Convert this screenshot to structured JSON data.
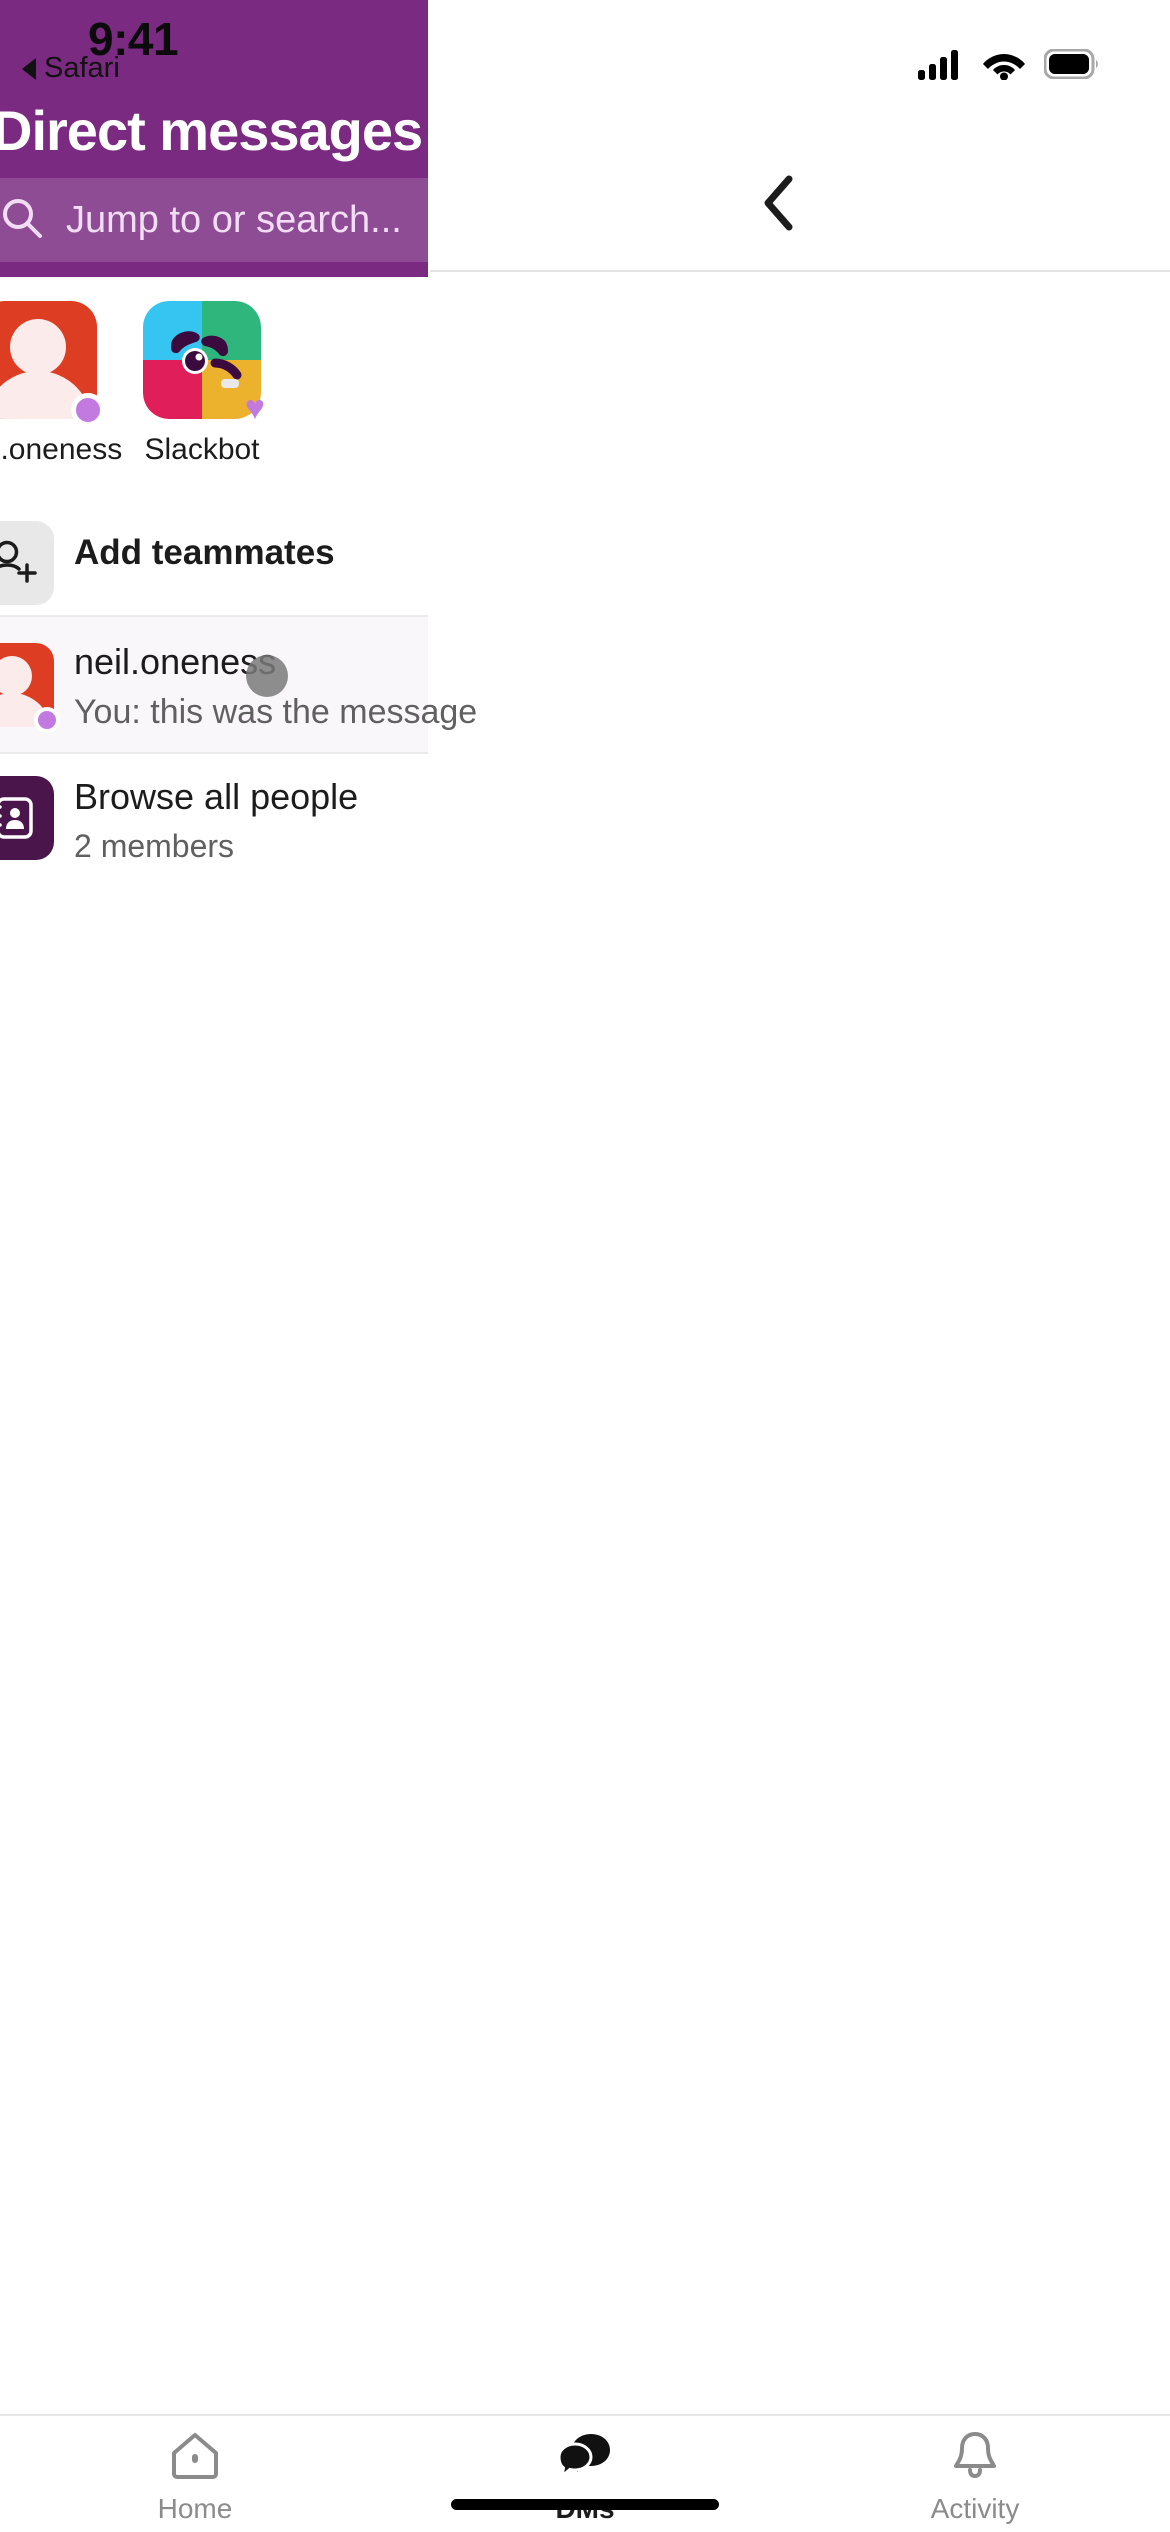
{
  "status_bar": {
    "time": "9:41",
    "return_app_label": "Safari",
    "return_arrow_icon": "back-triangle-icon",
    "cellular_icon": "cellular-signal-icon",
    "wifi_icon": "wifi-icon",
    "battery_icon": "battery-full-icon"
  },
  "right_pane": {
    "back_icon": "chevron-left-icon"
  },
  "left_panel": {
    "title": "Direct messages",
    "background_color": "#7a2a80",
    "search": {
      "icon": "search-icon",
      "placeholder": "Jump to or search...",
      "value": "",
      "background_color": "#8e4c94"
    }
  },
  "recents": [
    {
      "name": "neil.oneness",
      "avatar": "user-avatar-red",
      "avatar_color": "#dd3d22",
      "badge": "presence-online-dot",
      "badge_color": "#c27ae0"
    },
    {
      "name": "Slackbot",
      "avatar": "slackbot-avatar",
      "badge": "heart-icon",
      "badge_color": "#c27ae0"
    }
  ],
  "add_teammates": {
    "label": "Add teammates",
    "icon": "person-add-icon"
  },
  "conversations": [
    {
      "name": "neil.oneness",
      "preview": "You: this was the message",
      "avatar": "user-avatar-red",
      "avatar_color": "#dd3d22",
      "badge_color": "#c27ae0",
      "selected": true
    }
  ],
  "browse_all_people": {
    "title": "Browse all people",
    "subtitle": "2 members",
    "icon": "contact-book-icon",
    "icon_color": "#4a154b"
  },
  "tab_bar": {
    "tabs": [
      {
        "label": "Home",
        "icon": "home-icon",
        "active": false
      },
      {
        "label": "DMs",
        "icon": "chat-bubbles-icon",
        "active": true
      },
      {
        "label": "Activity",
        "icon": "bell-icon",
        "active": false
      }
    ]
  }
}
